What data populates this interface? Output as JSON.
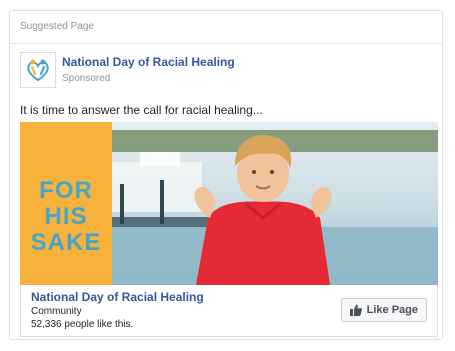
{
  "card": {
    "header_label": "Suggested Page"
  },
  "page": {
    "name": "National Day of Racial Healing",
    "sponsored_label": "Sponsored",
    "avatar_icon": "heart-figures-logo-icon"
  },
  "post": {
    "text": "It is time to answer the call for racial healing..."
  },
  "media": {
    "overlay_lines": [
      "FOR",
      "HIS",
      "SAKE"
    ],
    "overlay_bg_color": "#f6b23b",
    "overlay_text_color": "#48a5c8"
  },
  "footer": {
    "title": "National Day of Racial Healing",
    "category": "Community",
    "likes": "52,336 people like this.",
    "like_button_label": "Like Page",
    "like_icon": "thumbs-up-icon"
  },
  "colors": {
    "link": "#365899",
    "muted": "#90949c",
    "border": "#dddfe2"
  }
}
